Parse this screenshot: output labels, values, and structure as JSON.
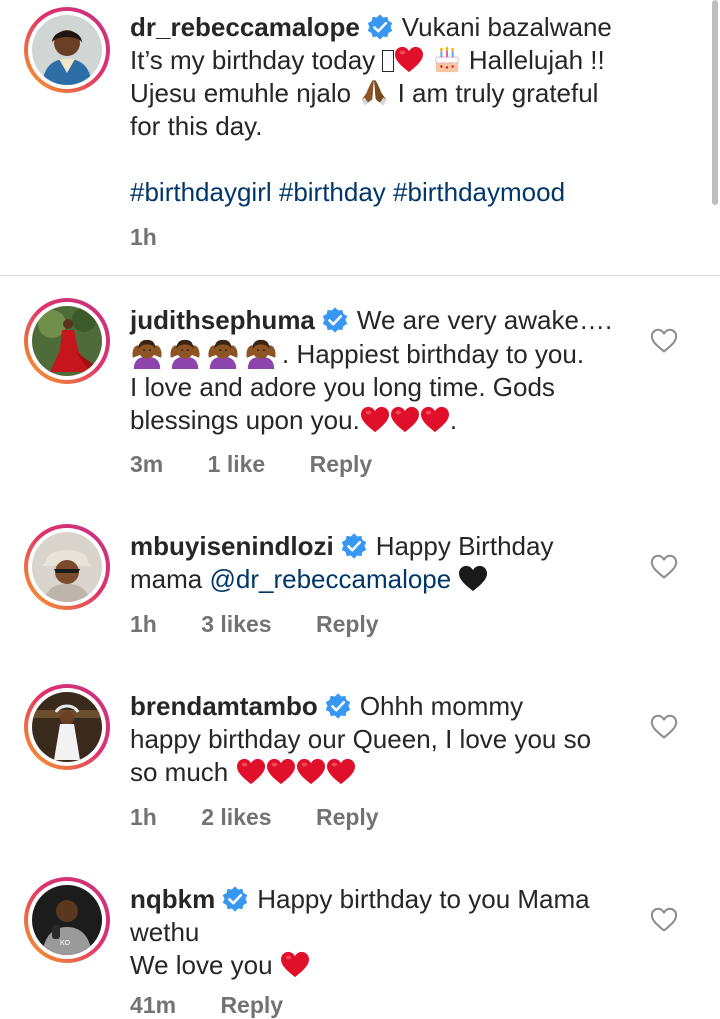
{
  "caption": {
    "username": "dr_rebeccamalope",
    "lines": [
      "Vukani bazalwane",
      "It’s my birthday today",
      "Hallelujah !!",
      "Ujesu emuhle njalo",
      "I am truly grateful",
      "for this day."
    ],
    "hashtags": "#birthdaygirl #birthday #birthdaymood",
    "time": "1h"
  },
  "comments": [
    {
      "username": "judithsephuma",
      "text_1": "We are very awake….",
      "text_2": ". Happiest birthday to you.",
      "text_3": "I love and adore you long time. Gods",
      "text_4": "blessings upon you.",
      "text_5": ".",
      "time": "3m",
      "likes": "1 like",
      "reply": "Reply"
    },
    {
      "username": "mbuyisenindlozi",
      "text_1": "Happy Birthday",
      "text_2": "mama",
      "mention": "@dr_rebeccamalope",
      "time": "1h",
      "likes": "3 likes",
      "reply": "Reply"
    },
    {
      "username": "brendamtambo",
      "text_1": "Ohhh mommy",
      "text_2": "happy birthday our Queen, I love you so",
      "text_3": "so much",
      "time": "1h",
      "likes": "2 likes",
      "reply": "Reply"
    },
    {
      "username": "nqbkm",
      "text_1": "Happy birthday to you Mama",
      "text_2": "wethu",
      "text_3": "We love you",
      "time": "41m",
      "reply": "Reply"
    }
  ],
  "colors": {
    "link": "#00376b",
    "meta": "#737373",
    "verified": "#3897f0",
    "heart": "#e0102a"
  },
  "icons": [
    "verified-badge-icon",
    "heart-outline-icon",
    "red-heart-icon",
    "black-heart-icon",
    "birthday-cake-icon",
    "folded-hands-icon",
    "woman-gesturing-ok-icon"
  ]
}
